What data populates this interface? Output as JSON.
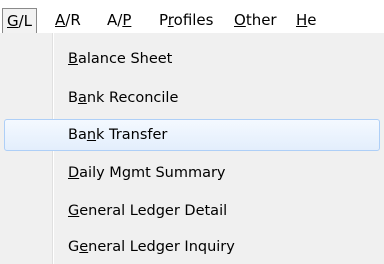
{
  "menubar": {
    "items": [
      {
        "pre": "",
        "key": "G",
        "post": "/L"
      },
      {
        "pre": "",
        "key": "A",
        "post": "/R"
      },
      {
        "pre": "A/",
        "key": "P",
        "post": ""
      },
      {
        "pre": "P",
        "key": "r",
        "post": "ofiles"
      },
      {
        "pre": "",
        "key": "O",
        "post": "ther"
      },
      {
        "pre": "",
        "key": "H",
        "post": "e"
      }
    ]
  },
  "menu": {
    "items": [
      {
        "pre": "",
        "key": "B",
        "post": "alance Sheet"
      },
      {
        "pre": "B",
        "key": "a",
        "post": "nk Reconcile"
      },
      {
        "pre": "Ba",
        "key": "n",
        "post": "k Transfer"
      },
      {
        "pre": "",
        "key": "D",
        "post": "aily Mgmt Summary"
      },
      {
        "pre": "",
        "key": "G",
        "post": "eneral Ledger Detail"
      },
      {
        "pre": "G",
        "key": "e",
        "post": "neral Ledger Inquiry"
      }
    ]
  }
}
